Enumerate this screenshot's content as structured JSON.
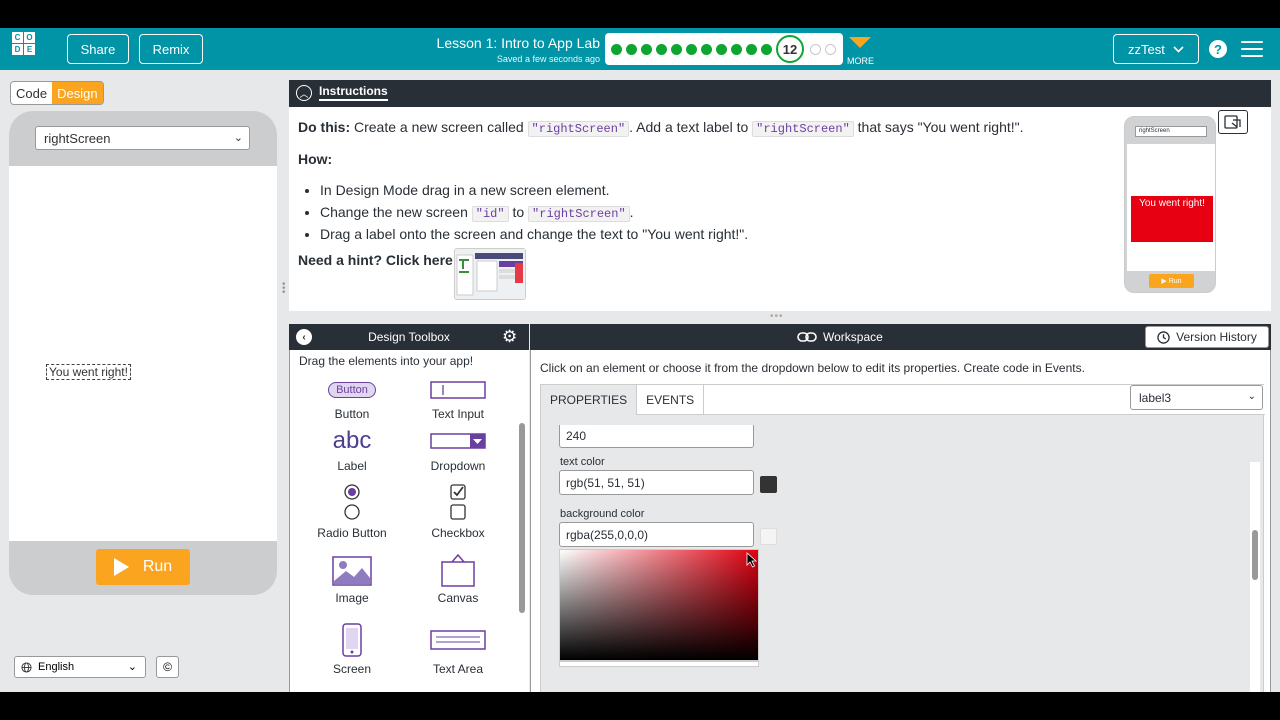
{
  "header": {
    "logo_letters": [
      "C",
      "O",
      "D",
      "E"
    ],
    "share_label": "Share",
    "remix_label": "Remix",
    "lesson_title": "Lesson 1: Intro to App Lab",
    "saved_status": "Saved a few seconds ago",
    "current_level": "12",
    "completed_levels": 11,
    "remaining_levels": 2,
    "more_label": "MORE",
    "user_name": "zzTest",
    "help_icon": "question-mark-icon",
    "menu_icon": "hamburger-icon"
  },
  "left_panel": {
    "mode_code": "Code",
    "mode_design": "Design",
    "screen_select_value": "rightScreen",
    "app_label_text": "You went right!",
    "run_label": "Run",
    "language_value": "English",
    "copyright_icon": "©"
  },
  "instructions": {
    "tab_label": "Instructions",
    "do_this_prefix": "Do this:",
    "do_this_text_1": " Create a new screen called ",
    "do_this_code_1": "\"rightScreen\"",
    "do_this_text_2": ". Add a text label to ",
    "do_this_code_2": "\"rightScreen\"",
    "do_this_text_3": " that says \"You went right!\".",
    "how_label": "How:",
    "step1": "In Design Mode drag in a new screen element.",
    "step2_a": "Change the new screen ",
    "step2_code1": "\"id\"",
    "step2_b": " to ",
    "step2_code2": "\"rightScreen\"",
    "step2_c": ".",
    "step3": "Drag a label onto the screen and change the text to \"You went right!\".",
    "hint_label": "Need a hint? Click here:",
    "preview_select": "rightScreen",
    "preview_label": "You went right!",
    "preview_run": "Run"
  },
  "toolbox": {
    "title": "Design Toolbox",
    "hint": "Drag the elements into your app!",
    "items": [
      {
        "label": "Button",
        "icon": "button-icon",
        "icon_text": "Button"
      },
      {
        "label": "Text Input",
        "icon": "text-input-icon"
      },
      {
        "label": "Label",
        "icon": "label-icon",
        "icon_text": "abc"
      },
      {
        "label": "Dropdown",
        "icon": "dropdown-icon"
      },
      {
        "label": "Radio Button",
        "icon": "radio-button-icon"
      },
      {
        "label": "Checkbox",
        "icon": "checkbox-icon"
      },
      {
        "label": "Image",
        "icon": "image-icon"
      },
      {
        "label": "Canvas",
        "icon": "canvas-icon"
      },
      {
        "label": "Screen",
        "icon": "screen-icon"
      },
      {
        "label": "Text Area",
        "icon": "text-area-icon"
      }
    ]
  },
  "workspace": {
    "title": "Workspace",
    "version_history_label": "Version History",
    "instruction": "Click on an element or choose it from the dropdown below to edit its properties. Create code in Events.",
    "tab_properties": "PROPERTIES",
    "tab_events": "EVENTS",
    "element_select_value": "label3",
    "height_value": "240",
    "text_color_label": "text color",
    "text_color_value": "rgb(51, 51, 51)",
    "text_color_swatch": "#333333",
    "bg_color_label": "background color",
    "bg_color_value": "rgba(255,0,0,0)"
  },
  "colors": {
    "header_teal": "#0094a6",
    "accent_orange": "#fba41f",
    "progress_green": "#0ea632",
    "dark_panel": "#292f36"
  }
}
